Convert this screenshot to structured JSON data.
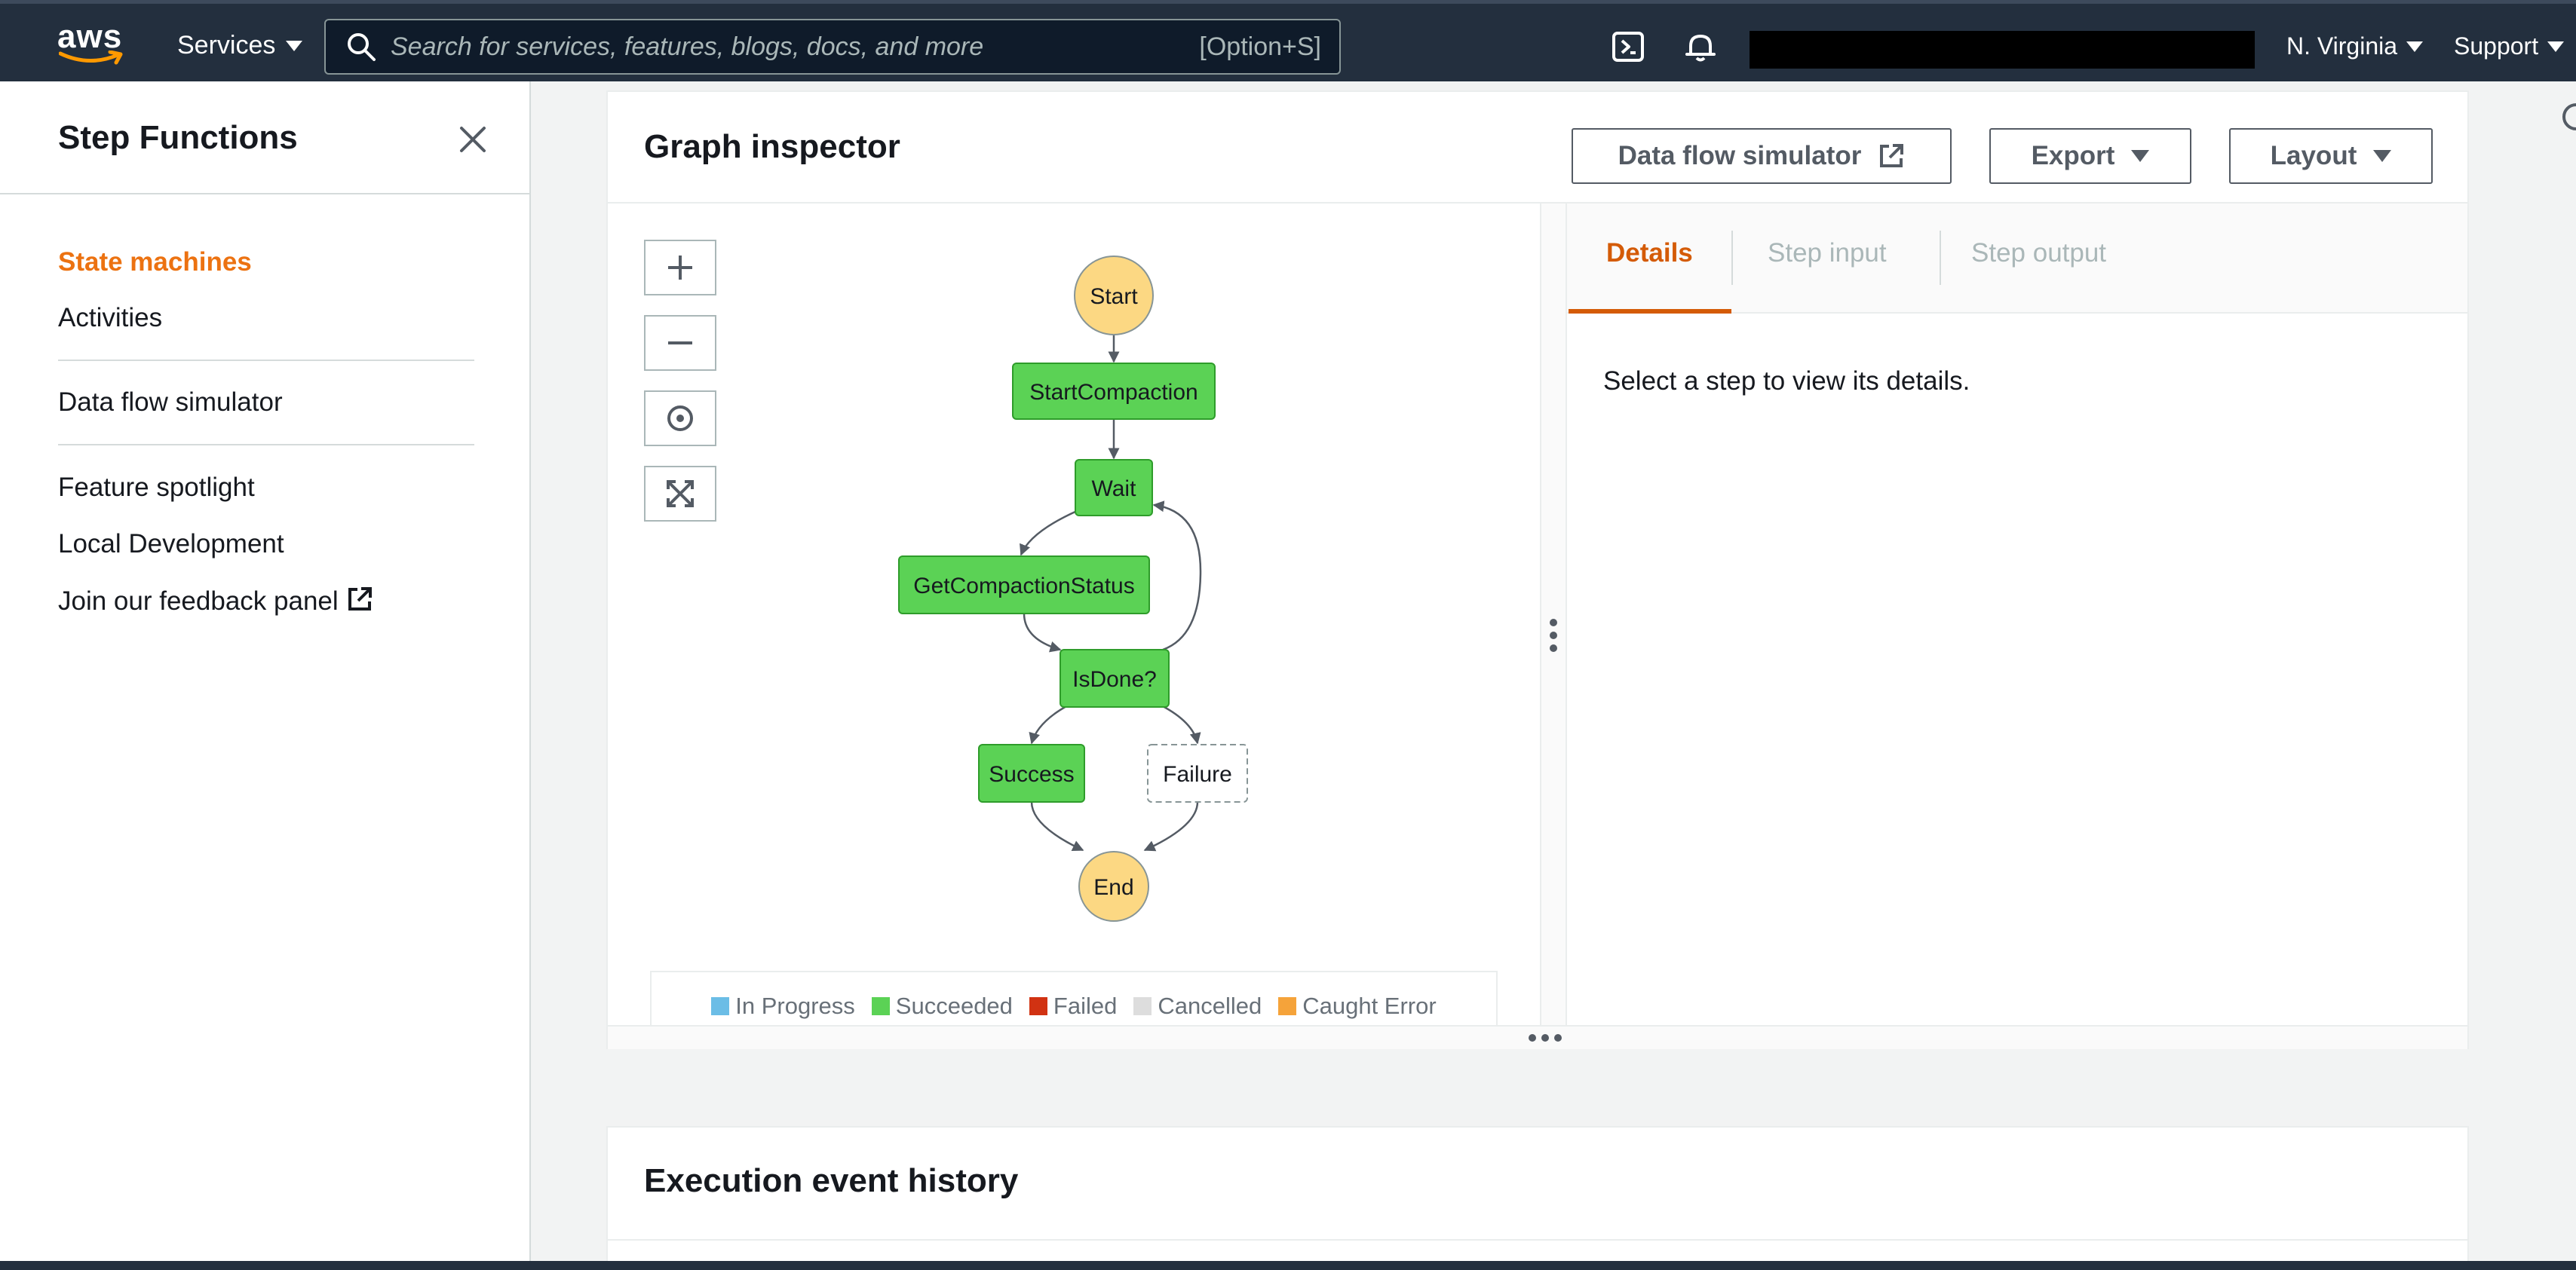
{
  "topnav": {
    "logo_text": "aws",
    "services_label": "Services",
    "search_placeholder": "Search for services, features, blogs, docs, and more",
    "search_shortcut": "[Option+S]",
    "region_label": "N. Virginia",
    "support_label": "Support",
    "icons": [
      "search-icon",
      "cloudshell-icon",
      "bell-icon"
    ]
  },
  "sidenav": {
    "title": "Step Functions",
    "items": [
      {
        "label": "State machines",
        "active": true
      },
      {
        "label": "Activities"
      },
      {
        "label": "Data flow simulator"
      },
      {
        "label": "Feature spotlight"
      },
      {
        "label": "Local Development"
      },
      {
        "label": "Join our feedback panel",
        "external": true
      }
    ]
  },
  "graph_inspector": {
    "title": "Graph inspector",
    "buttons": {
      "simulator": "Data flow simulator",
      "export": "Export",
      "layout": "Layout"
    },
    "graph": {
      "nodes": [
        {
          "id": "start",
          "label": "Start",
          "kind": "terminal"
        },
        {
          "id": "startcompaction",
          "label": "StartCompaction",
          "status": "Succeeded"
        },
        {
          "id": "wait",
          "label": "Wait",
          "status": "Succeeded"
        },
        {
          "id": "getcompactionstatus",
          "label": "GetCompactionStatus",
          "status": "Succeeded"
        },
        {
          "id": "isdone",
          "label": "IsDone?",
          "status": "Succeeded"
        },
        {
          "id": "success",
          "label": "Success",
          "status": "Succeeded"
        },
        {
          "id": "failure",
          "label": "Failure",
          "status": "Not run"
        },
        {
          "id": "end",
          "label": "End",
          "kind": "terminal"
        }
      ]
    },
    "legend": [
      {
        "label": "In Progress",
        "color": "#6bbde6"
      },
      {
        "label": "Succeeded",
        "color": "#5bd255"
      },
      {
        "label": "Failed",
        "color": "#d13212"
      },
      {
        "label": "Cancelled",
        "color": "#dddddd"
      },
      {
        "label": "Caught Error",
        "color": "#f5a33a"
      }
    ],
    "tabs": [
      "Details",
      "Step input",
      "Step output"
    ],
    "details_message": "Select a step to view its details."
  },
  "event_history": {
    "title": "Execution event history"
  },
  "colors": {
    "nav_bg": "#232f3e",
    "accent": "#ec7211",
    "tab_active": "#d45b07",
    "succeeded": "#5bd255",
    "terminal": "#fcd883"
  }
}
